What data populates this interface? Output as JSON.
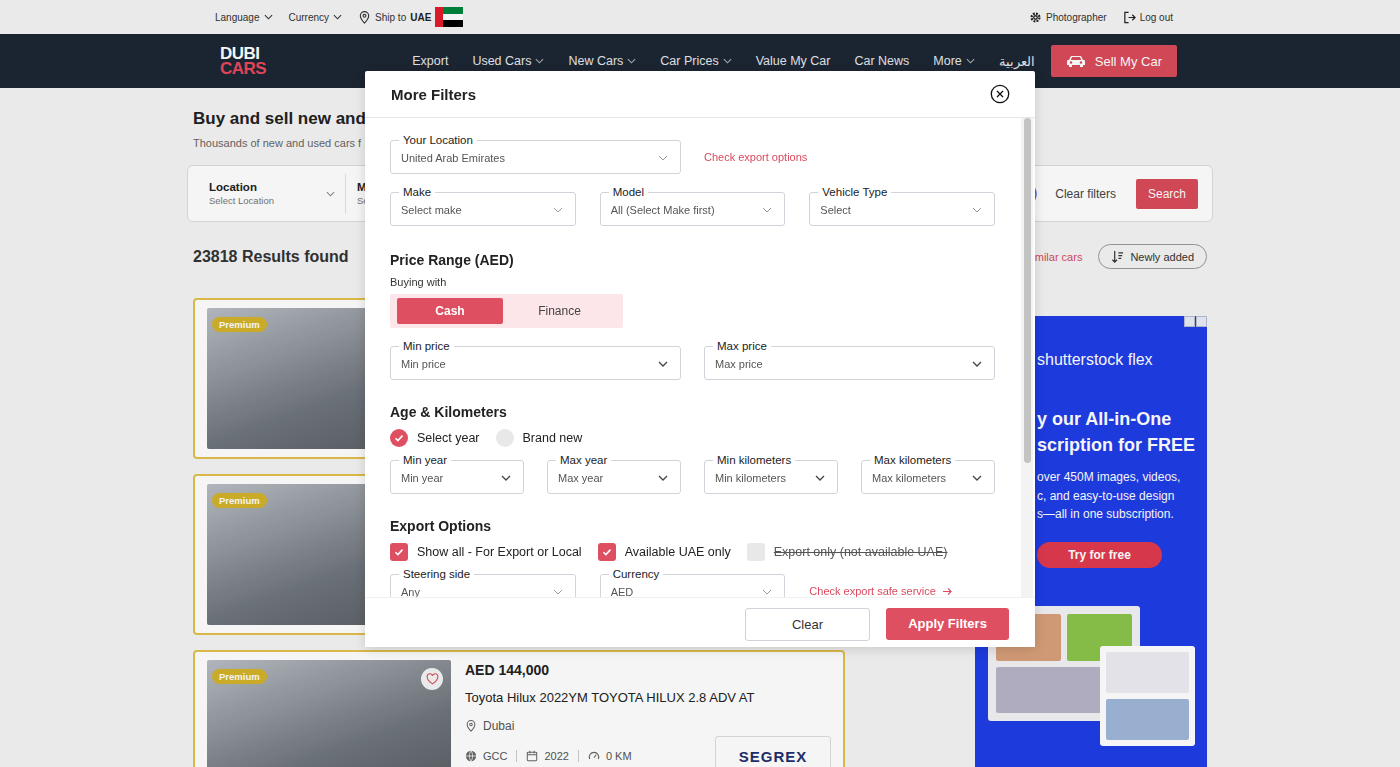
{
  "topbar": {
    "language": "Language",
    "currency": "Currency",
    "ship_to": "Ship to",
    "country": "UAE",
    "photographer": "Photographer",
    "logout": "Log out"
  },
  "logo": [
    "DUBI",
    "CARS"
  ],
  "nav": [
    {
      "label": "Export",
      "dropdown": false
    },
    {
      "label": "Used Cars",
      "dropdown": true
    },
    {
      "label": "New Cars",
      "dropdown": true
    },
    {
      "label": "Car Prices",
      "dropdown": true
    },
    {
      "label": "Value My Car",
      "dropdown": false
    },
    {
      "label": "Car News",
      "dropdown": false
    },
    {
      "label": "More",
      "dropdown": true
    },
    {
      "label": "العربية",
      "dropdown": false
    }
  ],
  "sell_button": "Sell My Car",
  "page": {
    "heading": "Buy and sell new and",
    "subheading": "Thousands of new and used cars f"
  },
  "search": {
    "fields": [
      {
        "label": "Location",
        "value": "Select Location",
        "dropdown": true
      },
      {
        "label": "M",
        "value": "Se",
        "dropdown": false
      }
    ],
    "clear": "Clear filters",
    "button": "Search"
  },
  "results": {
    "count": "23818 Results found",
    "similar": "imilar cars",
    "sort": "Newly added"
  },
  "listings": [
    {
      "badge": "Premium",
      "details": null
    },
    {
      "badge": "Premium",
      "details": null
    },
    {
      "badge": "Premium",
      "favorite": false,
      "details": {
        "price": "AED 144,000",
        "title": "Toyota Hilux 2022YM TOYOTA HILUX 2.8 ADV AT",
        "location": "Dubai",
        "spec": "GCC",
        "year": "2022",
        "mileage": "0 KM",
        "dealer": "SEGREX"
      }
    }
  ],
  "ad": {
    "brand": "shutterstock flex",
    "headline": [
      "y our All-in-One",
      "scription for FREE"
    ],
    "body": [
      "over 450M images, videos,",
      "c, and easy-to-use design",
      "s—all in one subscription."
    ],
    "cta": "Try for free"
  },
  "modal": {
    "title": "More Filters",
    "location": {
      "label": "Your Location",
      "value": "United Arab Emirates"
    },
    "export_link": "Check export options",
    "selects": [
      {
        "label": "Make",
        "value": "Select make"
      },
      {
        "label": "Model",
        "value": "All (Select Make first)"
      },
      {
        "label": "Vehicle Type",
        "value": "Select"
      }
    ],
    "price": {
      "title": "Price Range (AED)",
      "buying_with": "Buying with",
      "modes": [
        {
          "label": "Cash",
          "selected": true
        },
        {
          "label": "Finance",
          "selected": false
        }
      ],
      "fields": [
        {
          "label": "Min price",
          "value": "Min price"
        },
        {
          "label": "Max price",
          "value": "Max price"
        }
      ]
    },
    "age": {
      "title": "Age & Kilometers",
      "options": [
        {
          "label": "Select year",
          "selected": true
        },
        {
          "label": "Brand new",
          "selected": false
        }
      ],
      "fields": [
        {
          "label": "Min year",
          "value": "Min year"
        },
        {
          "label": "Max year",
          "value": "Max year"
        },
        {
          "label": "Min kilometers",
          "value": "Min kilometers"
        },
        {
          "label": "Max kilometers",
          "value": "Max kilometers"
        }
      ]
    },
    "export": {
      "title": "Export Options",
      "options": [
        {
          "label": "Show all - For Export or Local",
          "checked": true,
          "disabled": false
        },
        {
          "label": "Available UAE only",
          "checked": true,
          "disabled": false
        },
        {
          "label": "Export only (not available UAE)",
          "checked": false,
          "disabled": true
        }
      ],
      "fields": [
        {
          "label": "Steering side",
          "value": "Any"
        },
        {
          "label": "Currency",
          "value": "AED"
        }
      ],
      "safe_link": "Check export safe service"
    },
    "scroll": {
      "level": 0.72
    },
    "buttons": {
      "clear": "Clear",
      "apply": "Apply Filters"
    }
  }
}
